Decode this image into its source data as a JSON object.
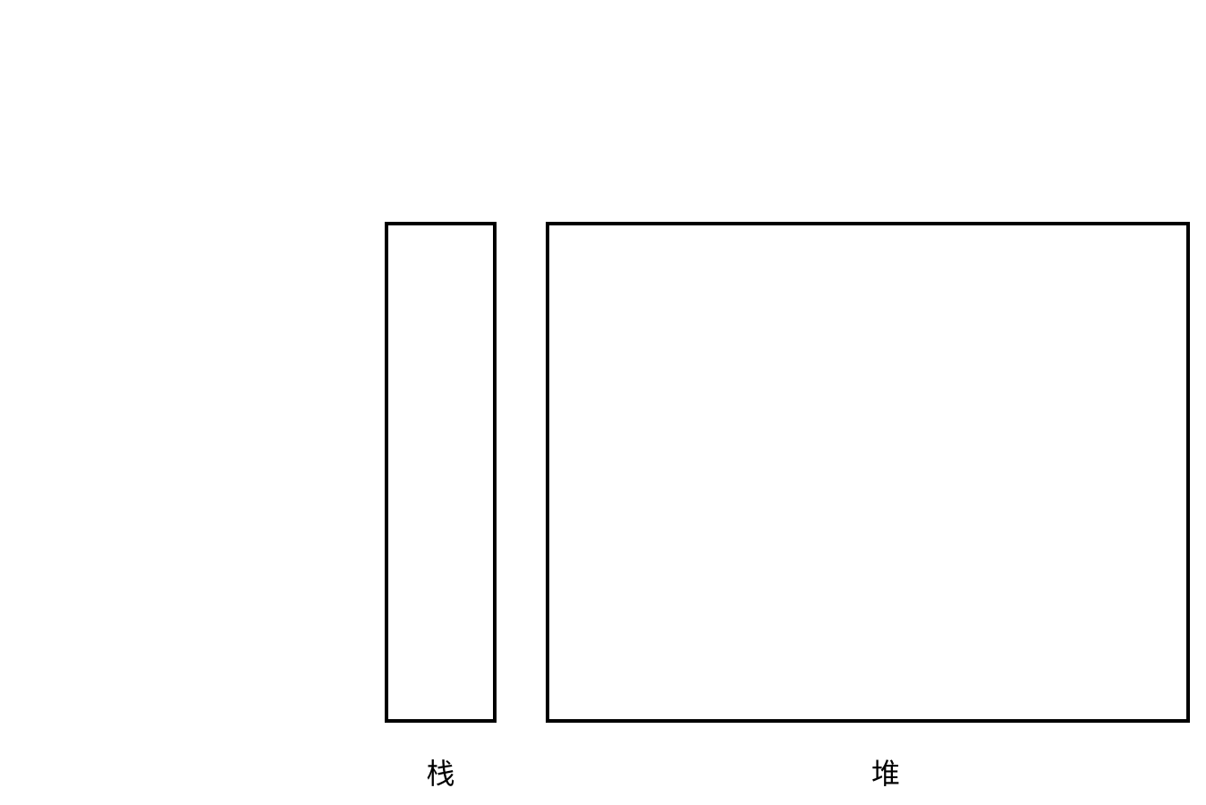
{
  "diagram": {
    "stack_label": "栈",
    "heap_label": "堆"
  }
}
